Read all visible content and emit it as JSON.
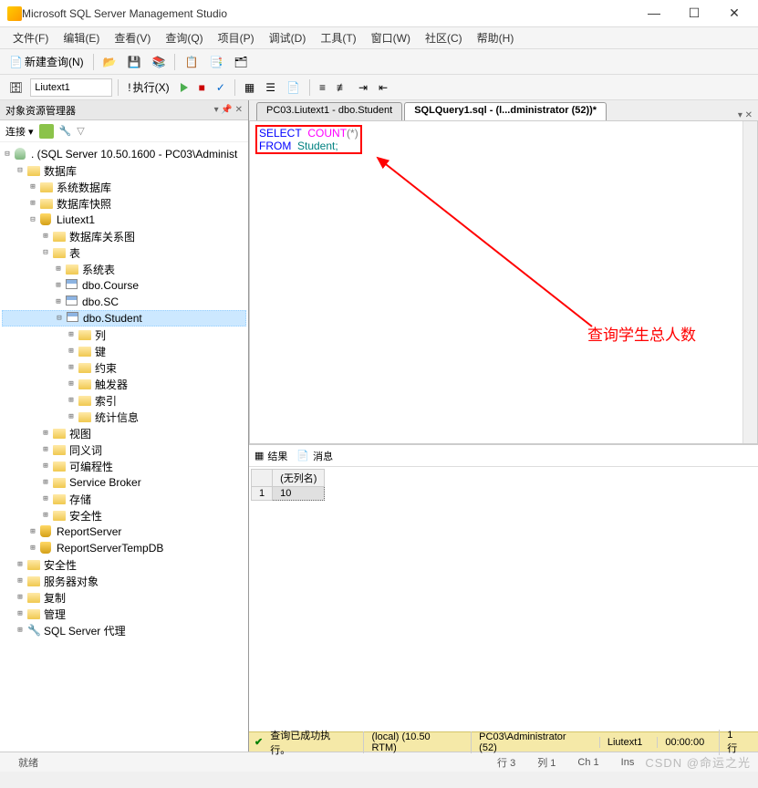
{
  "window": {
    "title": "Microsoft SQL Server Management Studio"
  },
  "menu": {
    "file": "文件(F)",
    "edit": "编辑(E)",
    "view": "查看(V)",
    "query": "查询(Q)",
    "project": "项目(P)",
    "debug": "调试(D)",
    "tools": "工具(T)",
    "window": "窗口(W)",
    "community": "社区(C)",
    "help": "帮助(H)"
  },
  "toolbar": {
    "new_query": "新建查询(N)",
    "db_combo": "Liutext1",
    "execute": "执行(X)"
  },
  "object_explorer": {
    "title": "对象资源管理器",
    "connect_label": "连接 ▾",
    "server": ". (SQL Server 10.50.1600 - PC03\\Administ",
    "nodes": {
      "databases": "数据库",
      "sys_db": "系统数据库",
      "db_snap": "数据库快照",
      "liutext1": "Liutext1",
      "db_diagram": "数据库关系图",
      "tables": "表",
      "sys_tables": "系统表",
      "course": "dbo.Course",
      "sc": "dbo.SC",
      "student": "dbo.Student",
      "columns": "列",
      "keys": "键",
      "constraints": "约束",
      "triggers": "触发器",
      "indexes": "索引",
      "stats": "统计信息",
      "views": "视图",
      "synonyms": "同义词",
      "programmability": "可编程性",
      "service_broker": "Service Broker",
      "storage": "存储",
      "security": "安全性",
      "report_server": "ReportServer",
      "report_server_temp": "ReportServerTempDB",
      "security2": "安全性",
      "server_objects": "服务器对象",
      "replication": "复制",
      "management": "管理",
      "sql_agent": "SQL Server 代理"
    }
  },
  "tabs": {
    "tab1": "PC03.Liutext1 - dbo.Student",
    "tab2": "SQLQuery1.sql - (l...dministrator (52))*"
  },
  "sql": {
    "select_kw": "SELECT",
    "count_fn": "COUNT",
    "star": "(*)",
    "from_kw": "FROM",
    "table": "Student;"
  },
  "annotation": {
    "text": "查询学生总人数"
  },
  "results": {
    "tab_results": "结果",
    "tab_messages": "消息",
    "col_header": "(无列名)",
    "row_num": "1",
    "value": "10"
  },
  "exec_status": {
    "success": "查询已成功执行。",
    "server": "(local) (10.50 RTM)",
    "user": "PC03\\Administrator (52)",
    "db": "Liutext1",
    "time": "00:00:00",
    "rows": "1 行"
  },
  "bottom_status": {
    "ready": "就绪",
    "line": "行 3",
    "col": "列 1",
    "ch": "Ch 1",
    "ins": "Ins"
  },
  "watermark": "CSDN @命运之光"
}
